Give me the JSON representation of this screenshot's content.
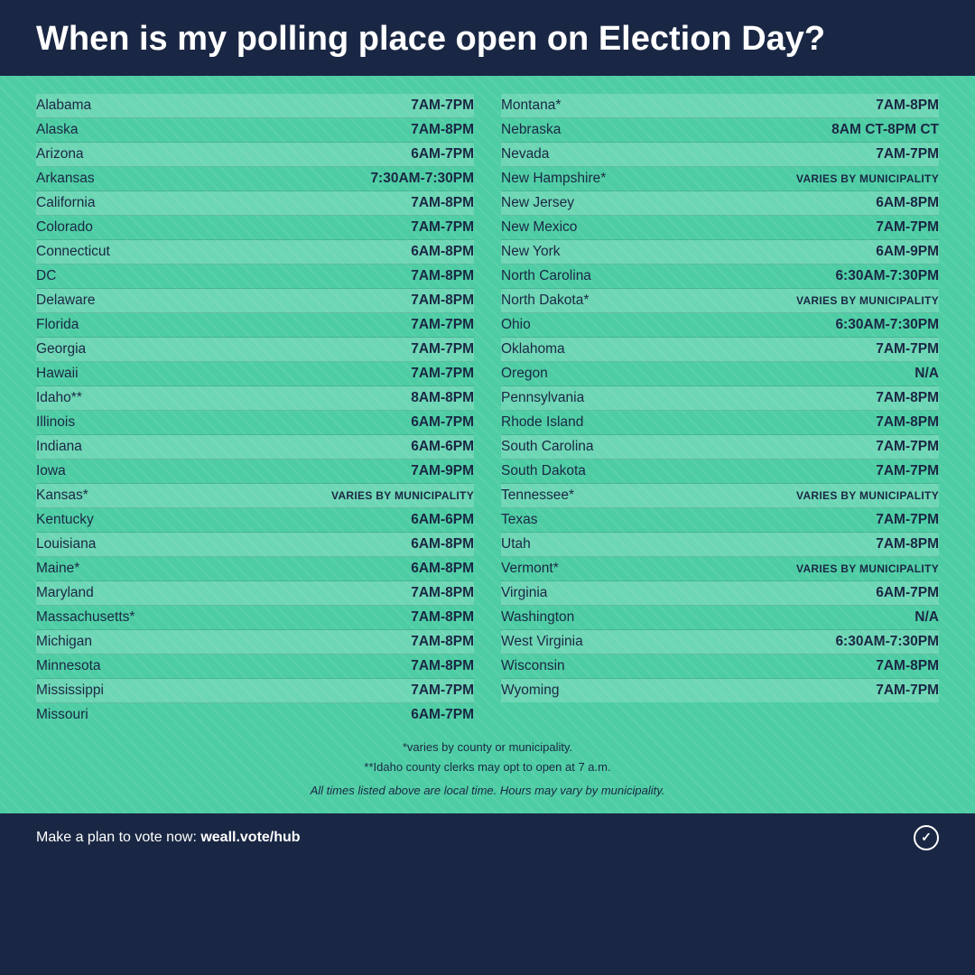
{
  "header": {
    "title": "When is my polling place open on Election Day?"
  },
  "left_column": [
    {
      "state": "Alabama",
      "hours": "7AM-7PM"
    },
    {
      "state": "Alaska",
      "hours": "7AM-8PM"
    },
    {
      "state": "Arizona",
      "hours": "6AM-7PM"
    },
    {
      "state": "Arkansas",
      "hours": "7:30AM-7:30PM"
    },
    {
      "state": "California",
      "hours": "7AM-8PM"
    },
    {
      "state": "Colorado",
      "hours": "7AM-7PM"
    },
    {
      "state": "Connecticut",
      "hours": "6AM-8PM"
    },
    {
      "state": "DC",
      "hours": "7AM-8PM"
    },
    {
      "state": "Delaware",
      "hours": "7AM-8PM"
    },
    {
      "state": "Florida",
      "hours": "7AM-7PM"
    },
    {
      "state": "Georgia",
      "hours": "7AM-7PM"
    },
    {
      "state": "Hawaii",
      "hours": "7AM-7PM"
    },
    {
      "state": "Idaho**",
      "hours": "8AM-8PM"
    },
    {
      "state": "Illinois",
      "hours": "6AM-7PM"
    },
    {
      "state": "Indiana",
      "hours": "6AM-6PM"
    },
    {
      "state": "Iowa",
      "hours": "7AM-9PM"
    },
    {
      "state": "Kansas*",
      "hours": "VARIES BY MUNICIPALITY",
      "varies": true
    },
    {
      "state": "Kentucky",
      "hours": "6AM-6PM"
    },
    {
      "state": "Louisiana",
      "hours": "6AM-8PM"
    },
    {
      "state": "Maine*",
      "hours": "6AM-8PM"
    },
    {
      "state": "Maryland",
      "hours": "7AM-8PM"
    },
    {
      "state": "Massachusetts*",
      "hours": "7AM-8PM"
    },
    {
      "state": "Michigan",
      "hours": "7AM-8PM"
    },
    {
      "state": "Minnesota",
      "hours": "7AM-8PM"
    },
    {
      "state": "Mississippi",
      "hours": "7AM-7PM"
    },
    {
      "state": "Missouri",
      "hours": "6AM-7PM"
    }
  ],
  "right_column": [
    {
      "state": "Montana*",
      "hours": "7AM-8PM"
    },
    {
      "state": "Nebraska",
      "hours": "8AM CT-8PM CT"
    },
    {
      "state": "Nevada",
      "hours": "7AM-7PM"
    },
    {
      "state": "New Hampshire*",
      "hours": "VARIES BY MUNICIPALITY",
      "varies": true
    },
    {
      "state": "New Jersey",
      "hours": "6AM-8PM"
    },
    {
      "state": "New Mexico",
      "hours": "7AM-7PM"
    },
    {
      "state": "New York",
      "hours": "6AM-9PM"
    },
    {
      "state": "North Carolina",
      "hours": "6:30AM-7:30PM"
    },
    {
      "state": "North Dakota*",
      "hours": "VARIES BY MUNICIPALITY",
      "varies": true
    },
    {
      "state": "Ohio",
      "hours": "6:30AM-7:30PM"
    },
    {
      "state": "Oklahoma",
      "hours": "7AM-7PM"
    },
    {
      "state": "Oregon",
      "hours": "N/A"
    },
    {
      "state": "Pennsylvania",
      "hours": "7AM-8PM"
    },
    {
      "state": "Rhode Island",
      "hours": "7AM-8PM"
    },
    {
      "state": "South Carolina",
      "hours": "7AM-7PM"
    },
    {
      "state": "South Dakota",
      "hours": "7AM-7PM"
    },
    {
      "state": "Tennessee*",
      "hours": "VARIES BY MUNICIPALITY",
      "varies": true
    },
    {
      "state": "Texas",
      "hours": "7AM-7PM"
    },
    {
      "state": "Utah",
      "hours": "7AM-8PM"
    },
    {
      "state": "Vermont*",
      "hours": "VARIES BY MUNICIPALITY",
      "varies": true
    },
    {
      "state": "Virginia",
      "hours": "6AM-7PM"
    },
    {
      "state": "Washington",
      "hours": "N/A"
    },
    {
      "state": "West Virginia",
      "hours": "6:30AM-7:30PM"
    },
    {
      "state": "Wisconsin",
      "hours": "7AM-8PM"
    },
    {
      "state": "Wyoming",
      "hours": "7AM-7PM"
    }
  ],
  "footnotes": {
    "line1": "*varies by county or municipality.",
    "line2": "**Idaho county clerks may opt to open at 7 a.m.",
    "line3": "All times listed above are local time. Hours may vary by municipality."
  },
  "footer": {
    "text": "Make a plan to vote now: ",
    "link": "weall.vote/hub"
  }
}
